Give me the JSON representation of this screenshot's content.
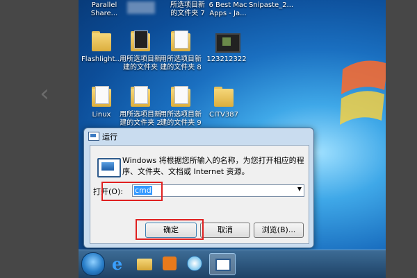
{
  "desktop": {
    "top_row": [
      {
        "label1": "Parallel",
        "label2": "Share..."
      },
      {
        "label1": "所选项目新",
        "label2": "的文件夹 7"
      },
      {
        "label1": "6 Best Mac",
        "label2": "Apps - Ja..."
      },
      {
        "label1": "Snipaste_2...",
        "label2": ""
      }
    ],
    "row2": [
      {
        "icon": "flashlight-folder-icon",
        "label1": "Flashlight...",
        "label2": ""
      },
      {
        "icon": "folder-icon",
        "label1": "用所选项目新",
        "label2": "建的文件夹"
      },
      {
        "icon": "folder-icon",
        "label1": "用所选项目新",
        "label2": "建的文件夹 8"
      },
      {
        "icon": "video-file-icon",
        "label1": "123212322",
        "label2": ""
      }
    ],
    "row3": [
      {
        "icon": "folder-icon",
        "label1": "Linux",
        "label2": ""
      },
      {
        "icon": "folder-icon",
        "label1": "用所选项目新",
        "label2": "建的文件夹 2"
      },
      {
        "icon": "folder-icon",
        "label1": "用所选项目新",
        "label2": "建的文件夹 9"
      },
      {
        "icon": "folder-icon",
        "label1": "CITV387",
        "label2": ""
      }
    ]
  },
  "run_dialog": {
    "title": "运行",
    "description": "Windows 将根据您所输入的名称，为您打开相应的程序、文件夹、文档或 Internet 资源。",
    "open_label": "打开(O):",
    "input_value": "cmd",
    "buttons": {
      "ok": "确定",
      "cancel": "取消",
      "browse": "浏览(B)..."
    }
  },
  "taskbar": {
    "items": [
      "start-orb",
      "internet-explorer",
      "windows-explorer",
      "media-player",
      "browser",
      "run"
    ]
  },
  "colors": {
    "highlight_red": "#e02020",
    "selection_blue": "#3399ff"
  }
}
